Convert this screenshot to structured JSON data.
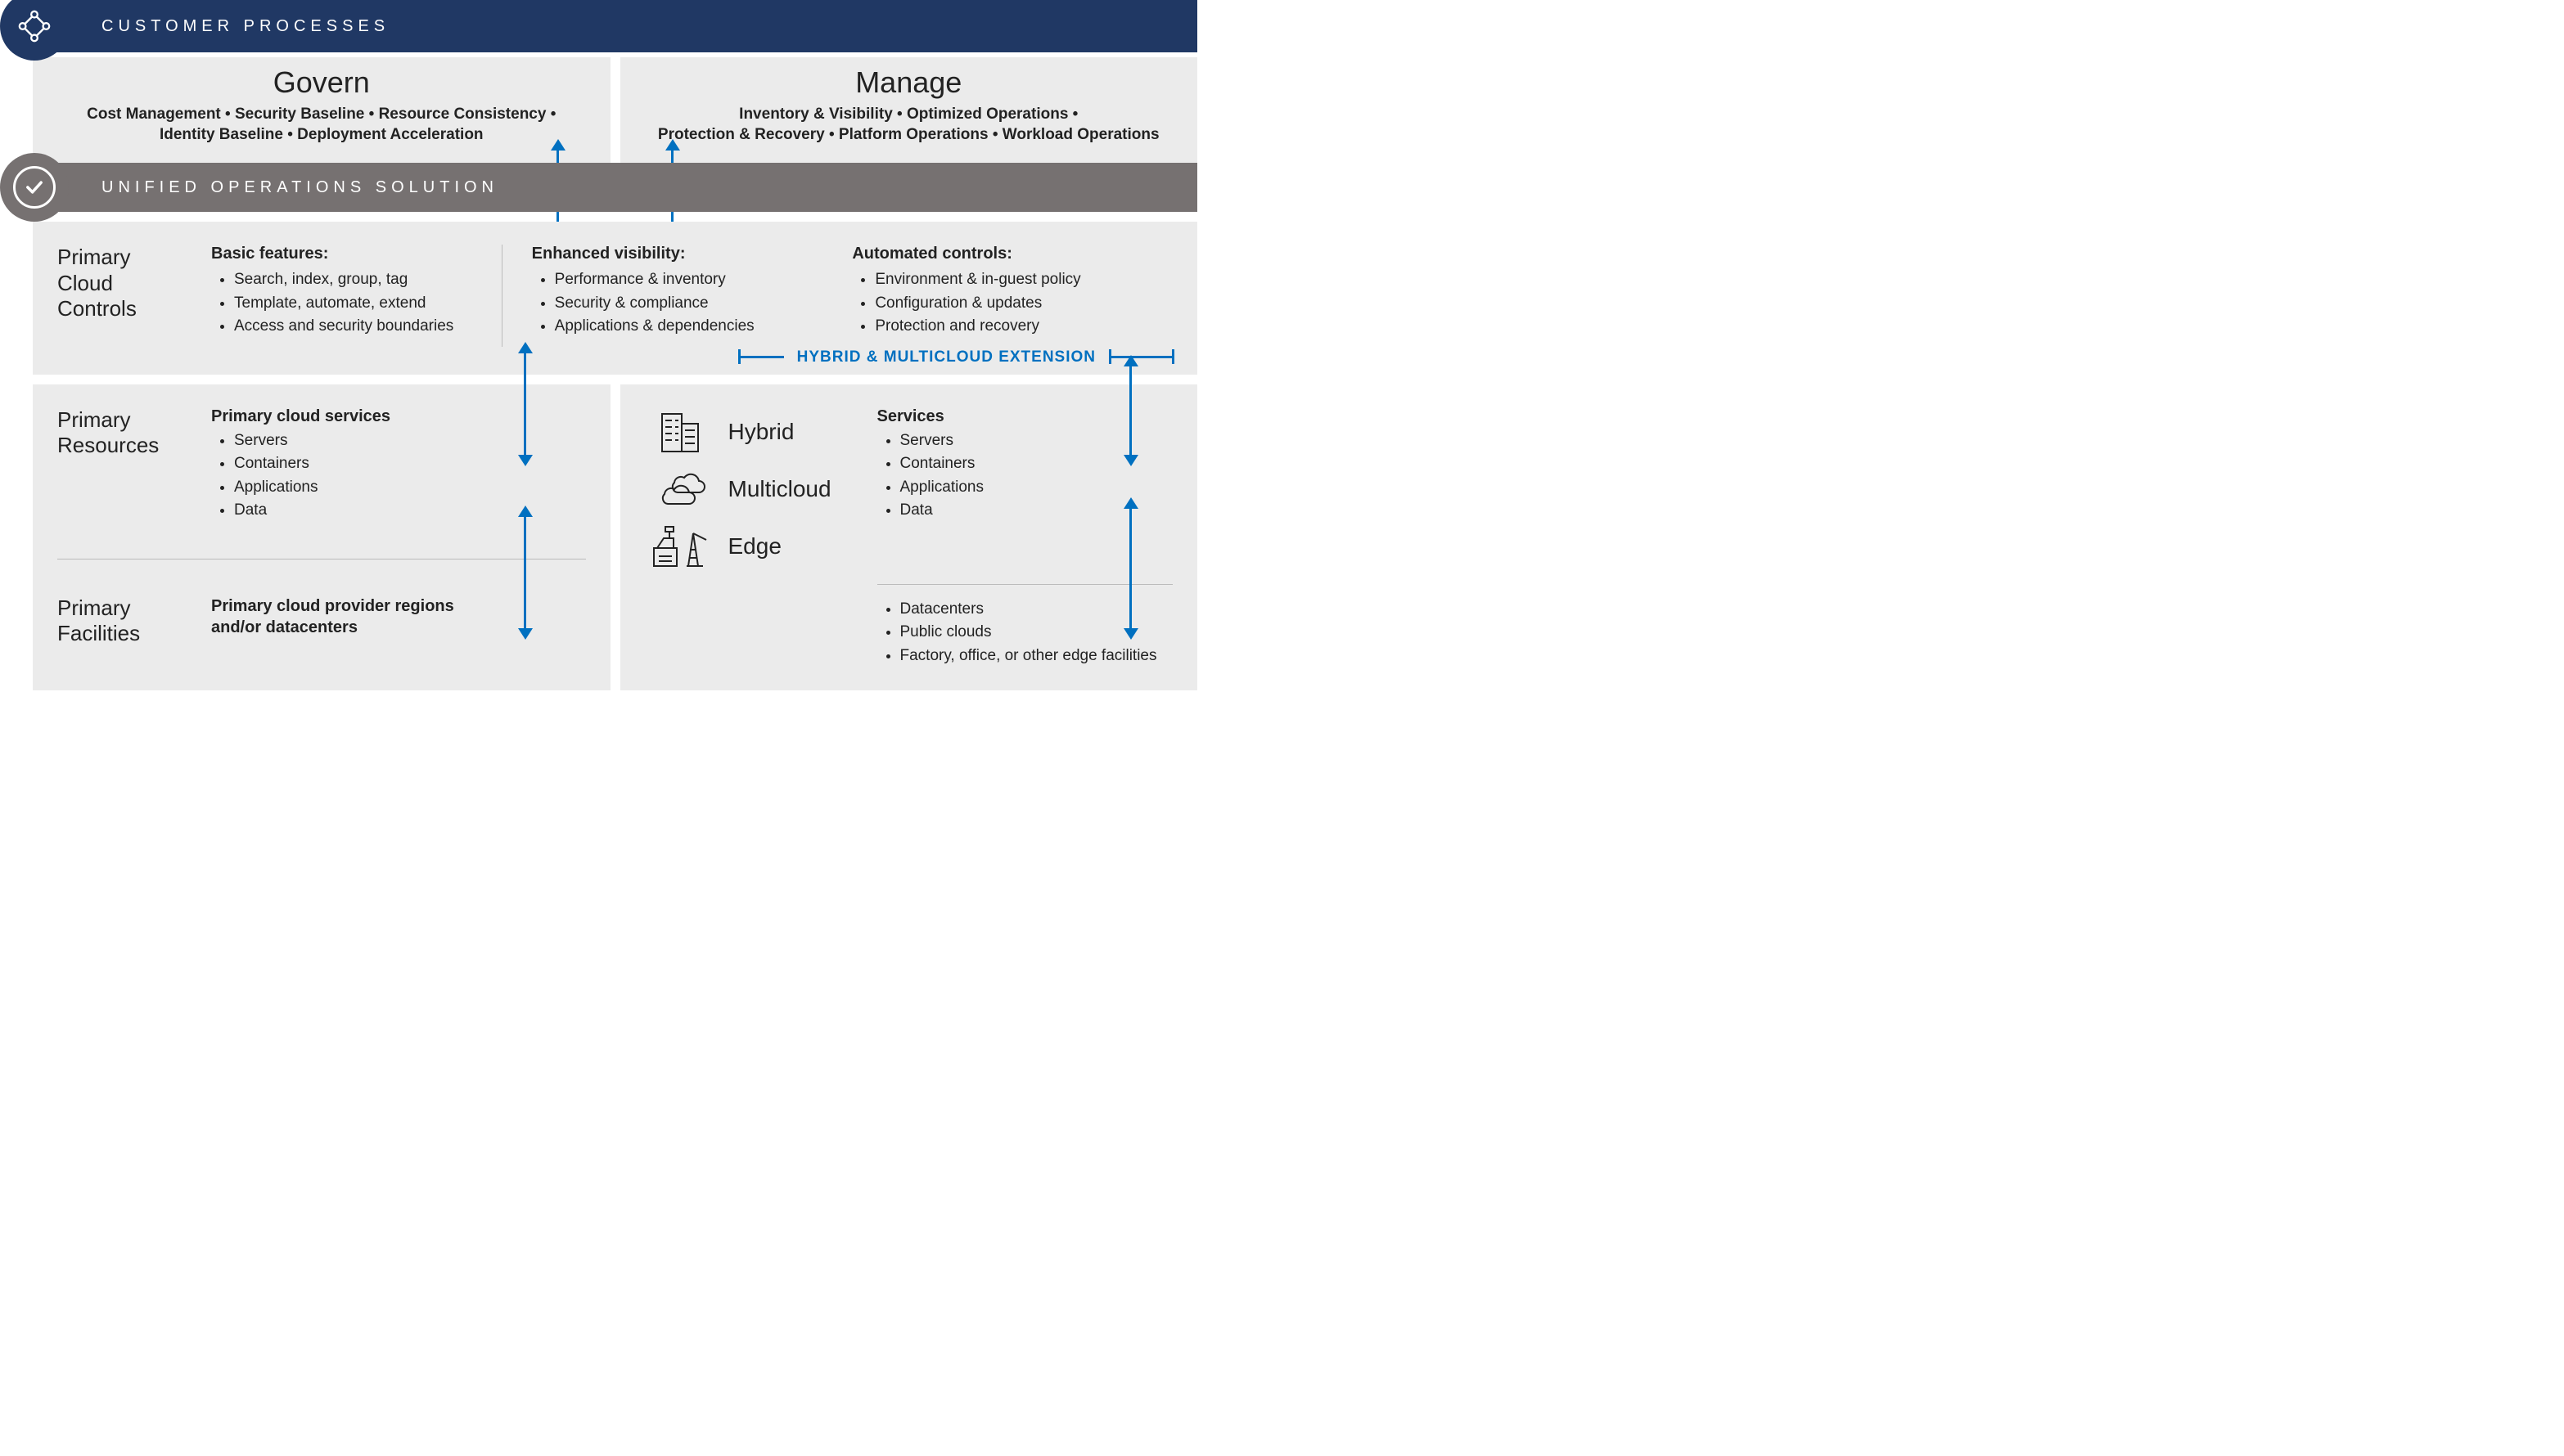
{
  "topbar": {
    "title": "CUSTOMER PROCESSES"
  },
  "govern": {
    "title": "Govern",
    "line1": "Cost Management • Security Baseline • Resource Consistency •",
    "line2": "Identity Baseline • Deployment Acceleration"
  },
  "manage": {
    "title": "Manage",
    "line1": "Inventory & Visibility • Optimized Operations •",
    "line2": "Protection & Recovery • Platform Operations • Workload Operations"
  },
  "unibar": {
    "title": "UNIFIED OPERATIONS SOLUTION"
  },
  "pcc": {
    "title_l1": "Primary",
    "title_l2": "Cloud",
    "title_l3": "Controls",
    "col1": {
      "heading": "Basic features:",
      "items": [
        "Search, index, group, tag",
        "Template, automate, extend",
        "Access and security boundaries"
      ]
    },
    "col2": {
      "heading": "Enhanced visibility:",
      "items": [
        "Performance & inventory",
        "Security & compliance",
        "Applications & dependencies"
      ]
    },
    "col3": {
      "heading": "Automated controls:",
      "items": [
        "Environment & in-guest policy",
        "Configuration & updates",
        "Protection and recovery"
      ]
    },
    "hybrid_ext": "HYBRID & MULTICLOUD EXTENSION"
  },
  "botleft": {
    "res_title_l1": "Primary",
    "res_title_l2": "Resources",
    "res_heading": "Primary cloud services",
    "res_items": [
      "Servers",
      "Containers",
      "Applications",
      "Data"
    ],
    "fac_title_l1": "Primary",
    "fac_title_l2": "Facilities",
    "fac_text_l1": "Primary cloud provider regions",
    "fac_text_l2": "and/or datacenters"
  },
  "botright": {
    "hybrid": "Hybrid",
    "multicloud": "Multicloud",
    "edge": "Edge",
    "svc_heading": "Services",
    "svc_items": [
      "Servers",
      "Containers",
      "Applications",
      "Data"
    ],
    "fac_items": [
      "Datacenters",
      "Public clouds",
      "Factory, office, or other edge facilities"
    ]
  }
}
